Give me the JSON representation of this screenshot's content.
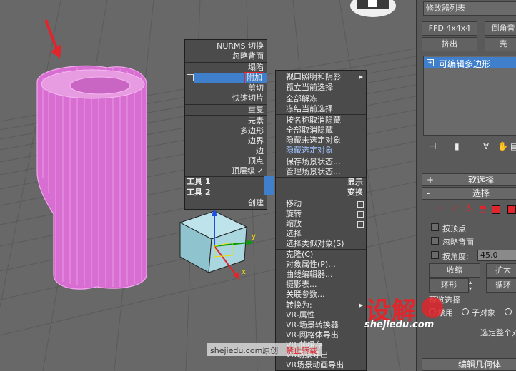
{
  "quad_left": {
    "items": [
      "NURMS 切换",
      "忽略背面",
      "塌陷",
      "附加",
      "剪切",
      "快速切片",
      "重复",
      "元素",
      "多边形",
      "边界",
      "边",
      "顶点",
      "顶层级"
    ],
    "tool1": "工具 1",
    "tool2": "工具 2",
    "create": "创建"
  },
  "quad_right": {
    "items": [
      "视口照明和阴影",
      "孤立当前选择",
      "全部解冻",
      "冻结当前选择",
      "按名称取消隐藏",
      "全部取消隐藏",
      "隐藏未选定对象",
      "隐藏选定对象",
      "保存场景状态...",
      "管理场景状态..."
    ],
    "display": "显示",
    "transform": "变换",
    "transform_items": [
      "移动",
      "旋转",
      "缩放",
      "选择",
      "选择类似对象(S)",
      "克隆(C)",
      "对象属性(P)...",
      "曲线编辑器...",
      "摄影表...",
      "关联参数...",
      "转换为:",
      "VR-属性",
      "VR-场景转换器",
      "VR-网格体导出",
      "VR-帧缓存",
      "VR场景导出",
      "VR场景动画导出"
    ]
  },
  "gizmo": {
    "axis_x": "x",
    "axis_y": "y"
  },
  "panel": {
    "modifier_list": "修改器列表",
    "ffd": "FFD 4x4x4",
    "chamfer": "倒角音",
    "extrude": "挤出",
    "shell": "壳",
    "stack_item": "可编辑多边形",
    "soft_select": "软选择",
    "select": "选择",
    "by_vertex": "按顶点",
    "ignore_backface": "忽略背面",
    "by_angle": "按角度:",
    "angle_value": "45.0",
    "shrink": "收缩",
    "grow": "扩大",
    "ring": "环形",
    "loop": "循环",
    "preview_select": "预览选择",
    "disable": "禁用",
    "sub_object": "子对象",
    "selected_whole": "选定整个对",
    "edit_geometry": "编辑几何体"
  },
  "watermark": {
    "brand": "设解",
    "brand_url": "shejiedu.com",
    "footer": "shejiedu.com原创",
    "footer_red": "禁止转载"
  },
  "colors": {
    "highlight": "#3f7fcc",
    "object": "#e79be0",
    "accent_red": "#e0262c"
  }
}
